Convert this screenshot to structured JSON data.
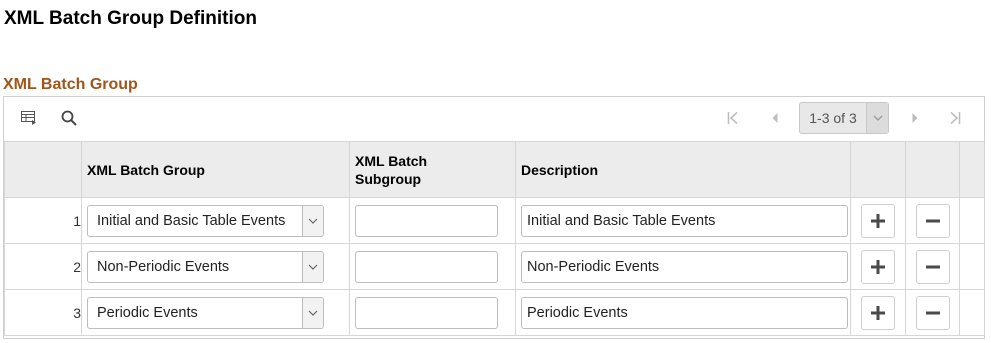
{
  "page": {
    "title": "XML Batch Group Definition"
  },
  "section": {
    "title": "XML Batch Group"
  },
  "toolbar": {
    "personalize_icon": "grid-personalize-icon",
    "find_icon": "search-icon",
    "pager_text": "1-3 of 3",
    "nav_icons": [
      "first-page-icon",
      "previous-page-icon",
      "next-page-icon",
      "last-page-icon"
    ]
  },
  "columns": {
    "group": "XML Batch Group",
    "subgroup": "XML Batch Subgroup",
    "description": "Description"
  },
  "rows": [
    {
      "num": "1",
      "group": "Initial and Basic Table Events",
      "subgroup": "",
      "description": "Initial and Basic Table Events"
    },
    {
      "num": "2",
      "group": "Non-Periodic Events",
      "subgroup": "",
      "description": "Non-Periodic Events"
    },
    {
      "num": "3",
      "group": "Periodic Events",
      "subgroup": "",
      "description": "Periodic Events"
    }
  ],
  "colors": {
    "section_title": "#a0551b",
    "header_bg": "#ececec",
    "border": "#d6d6d6"
  }
}
